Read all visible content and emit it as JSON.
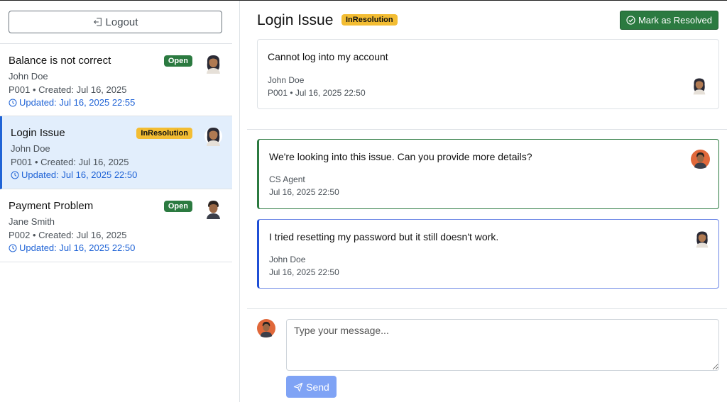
{
  "sidebar": {
    "logout_label": "Logout",
    "tickets": [
      {
        "title": "Balance is not correct",
        "status": "Open",
        "customer": "John Doe",
        "meta": "P001 • Created: Jul 16, 2025",
        "updated": "Updated: Jul 16, 2025 22:55"
      },
      {
        "title": "Login Issue",
        "status": "InResolution",
        "customer": "John Doe",
        "meta": "P001 • Created: Jul 16, 2025",
        "updated": "Updated: Jul 16, 2025 22:50"
      },
      {
        "title": "Payment Problem",
        "status": "Open",
        "customer": "Jane Smith",
        "meta": "P002 • Created: Jul 16, 2025",
        "updated": "Updated: Jul 16, 2025 22:50"
      }
    ]
  },
  "detail": {
    "title": "Login Issue",
    "status": "InResolution",
    "resolve_label": "Mark as Resolved",
    "description": {
      "text": "Cannot log into my account",
      "author": "John Doe",
      "meta": "P001 • Jul 16, 2025 22:50"
    },
    "messages": [
      {
        "text": "We're looking into this issue. Can you provide more details?",
        "author": "CS Agent",
        "time": "Jul 16, 2025 22:50"
      },
      {
        "text": "I tried resetting my password but it still doesn't work.",
        "author": "John Doe",
        "time": "Jul 16, 2025 22:50"
      }
    ]
  },
  "compose": {
    "placeholder": "Type your message...",
    "send_label": "Send"
  },
  "colors": {
    "open_badge": "#2b7a40",
    "inresolution_badge": "#f3bd33",
    "active_ticket_bg": "#e2eefc",
    "accent_blue": "#1f63d6",
    "agent_border": "#2b7a40",
    "customer_border": "#1f4fd6",
    "send_button": "#7fa3f5"
  }
}
